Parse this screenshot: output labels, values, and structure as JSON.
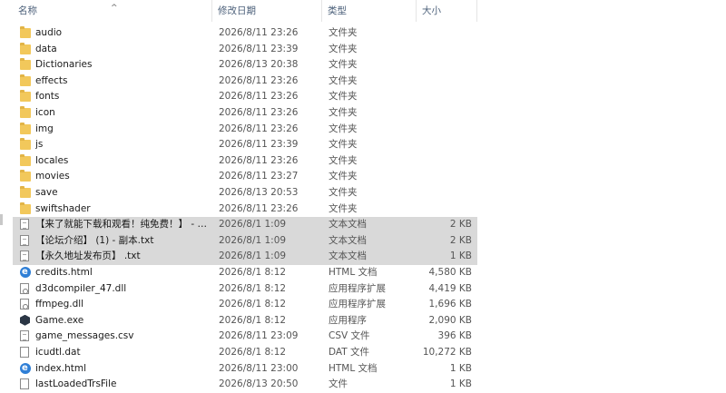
{
  "columns": {
    "name": "名称",
    "date": "修改日期",
    "type": "类型",
    "size": "大小"
  },
  "sort_indicator": "^",
  "files": [
    {
      "icon": "folder-icon",
      "name": "audio",
      "date": "2026/8/11 23:26",
      "type": "文件夹",
      "size": ""
    },
    {
      "icon": "folder-icon",
      "name": "data",
      "date": "2026/8/11 23:39",
      "type": "文件夹",
      "size": ""
    },
    {
      "icon": "folder-icon",
      "name": "Dictionaries",
      "date": "2026/8/13 20:38",
      "type": "文件夹",
      "size": ""
    },
    {
      "icon": "folder-icon",
      "name": "effects",
      "date": "2026/8/11 23:26",
      "type": "文件夹",
      "size": ""
    },
    {
      "icon": "folder-icon",
      "name": "fonts",
      "date": "2026/8/11 23:26",
      "type": "文件夹",
      "size": ""
    },
    {
      "icon": "folder-icon",
      "name": "icon",
      "date": "2026/8/11 23:26",
      "type": "文件夹",
      "size": ""
    },
    {
      "icon": "folder-icon",
      "name": "img",
      "date": "2026/8/11 23:26",
      "type": "文件夹",
      "size": ""
    },
    {
      "icon": "folder-icon",
      "name": "js",
      "date": "2026/8/11 23:39",
      "type": "文件夹",
      "size": ""
    },
    {
      "icon": "folder-icon",
      "name": "locales",
      "date": "2026/8/11 23:26",
      "type": "文件夹",
      "size": ""
    },
    {
      "icon": "folder-icon",
      "name": "movies",
      "date": "2026/8/11 23:27",
      "type": "文件夹",
      "size": ""
    },
    {
      "icon": "folder-icon",
      "name": "save",
      "date": "2026/8/13 20:53",
      "type": "文件夹",
      "size": ""
    },
    {
      "icon": "folder-icon",
      "name": "swiftshader",
      "date": "2026/8/11 23:26",
      "type": "文件夹",
      "size": ""
    },
    {
      "icon": "text-file-icon",
      "name": "【来了就能下载和观看！纯免费！】 - 副...",
      "date": "2026/8/1 1:09",
      "type": "文本文档",
      "size": "2 KB",
      "selected": true
    },
    {
      "icon": "text-file-icon",
      "name": "【论坛介绍】 (1) - 副本.txt",
      "date": "2026/8/1 1:09",
      "type": "文本文档",
      "size": "2 KB",
      "selected": true
    },
    {
      "icon": "text-file-icon",
      "name": "【永久地址发布页】 .txt",
      "date": "2026/8/1 1:09",
      "type": "文本文档",
      "size": "1 KB",
      "selected": true
    },
    {
      "icon": "html-file-icon",
      "name": "credits.html",
      "date": "2026/8/1 8:12",
      "type": "HTML 文档",
      "size": "4,580 KB"
    },
    {
      "icon": "dll-file-icon",
      "name": "d3dcompiler_47.dll",
      "date": "2026/8/1 8:12",
      "type": "应用程序扩展",
      "size": "4,419 KB"
    },
    {
      "icon": "dll-file-icon",
      "name": "ffmpeg.dll",
      "date": "2026/8/1 8:12",
      "type": "应用程序扩展",
      "size": "1,696 KB"
    },
    {
      "icon": "exe-file-icon",
      "name": "Game.exe",
      "date": "2026/8/1 8:12",
      "type": "应用程序",
      "size": "2,090 KB"
    },
    {
      "icon": "text-file-icon",
      "name": "game_messages.csv",
      "date": "2026/8/11 23:09",
      "type": "CSV 文件",
      "size": "396 KB"
    },
    {
      "icon": "generic-file-icon",
      "name": "icudtl.dat",
      "date": "2026/8/1 8:12",
      "type": "DAT 文件",
      "size": "10,272 KB"
    },
    {
      "icon": "html-file-icon",
      "name": "index.html",
      "date": "2026/8/11 23:00",
      "type": "HTML 文档",
      "size": "1 KB"
    },
    {
      "icon": "generic-file-icon",
      "name": "lastLoadedTrsFile",
      "date": "2026/8/13 20:50",
      "type": "文件",
      "size": "1 KB"
    }
  ]
}
